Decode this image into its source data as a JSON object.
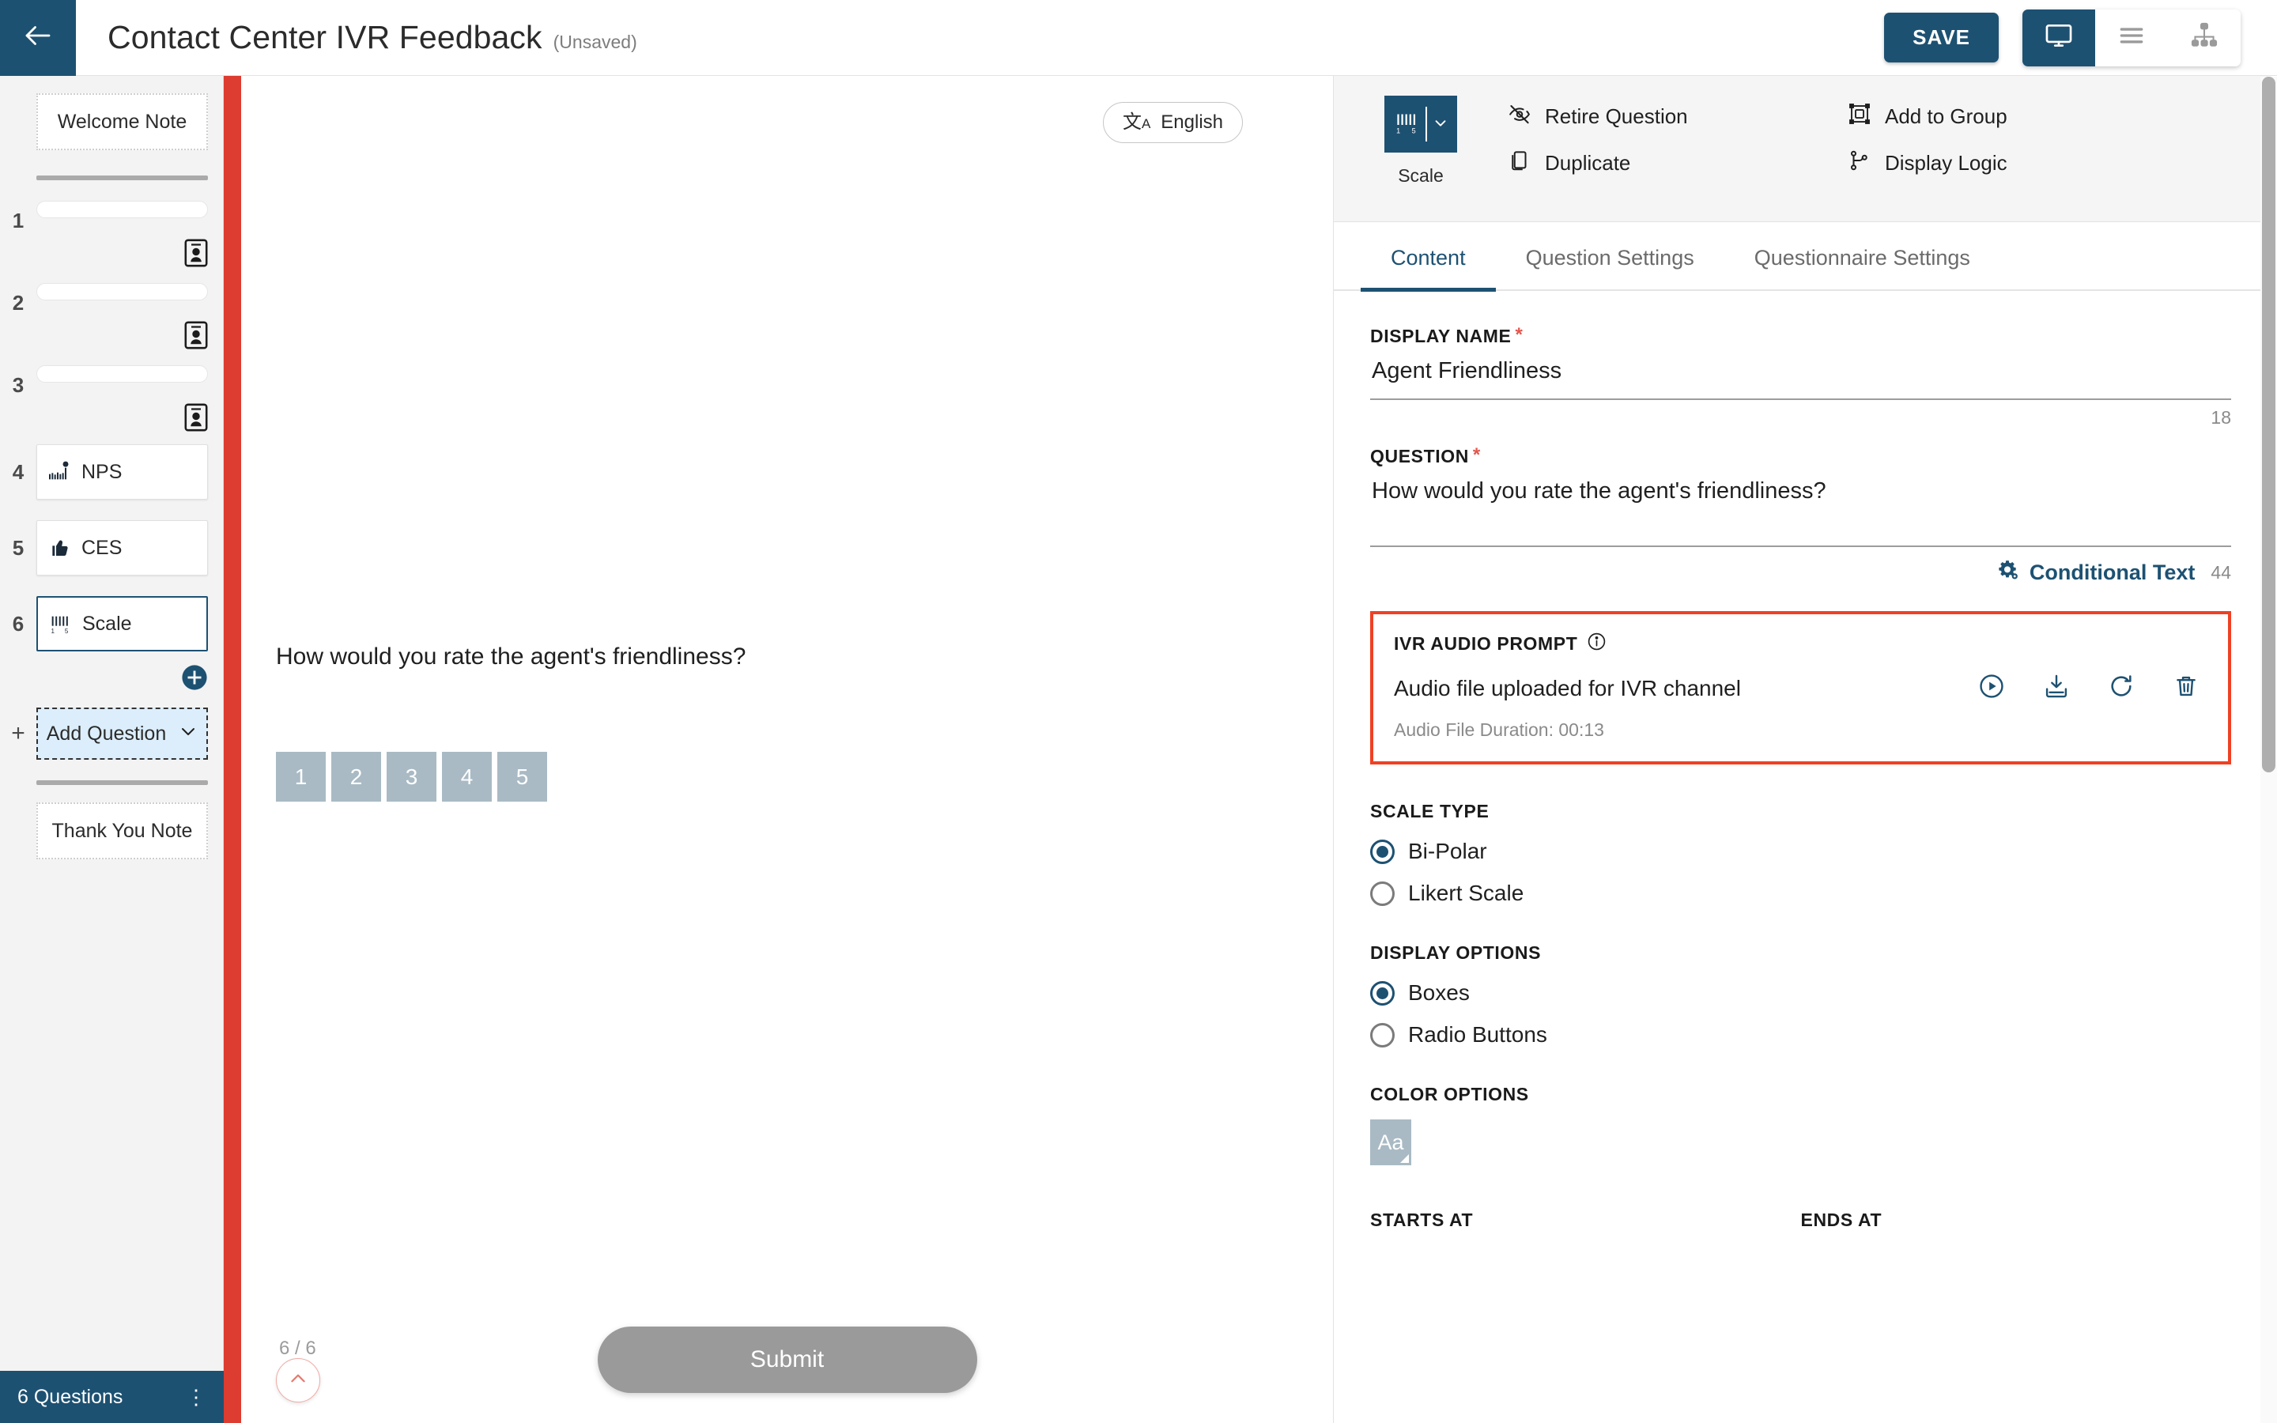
{
  "topbar": {
    "back_icon": "arrow-left-icon",
    "title": "Contact Center IVR Feedback",
    "status": "(Unsaved)",
    "save_label": "SAVE",
    "view_modes": [
      {
        "name": "desktop-preview",
        "icon": "monitor-icon",
        "active": true
      },
      {
        "name": "list-view",
        "icon": "list-icon",
        "active": false
      },
      {
        "name": "tree-view",
        "icon": "sitemap-icon",
        "active": false
      }
    ],
    "accent_color": "#1d5172"
  },
  "sidebar": {
    "welcome_note": "Welcome Note",
    "thank_you_note": "Thank You Note",
    "questions": [
      {
        "num": "1",
        "label": "",
        "type": "placeholder",
        "icon": "contact-card-icon",
        "selected": false
      },
      {
        "num": "2",
        "label": "",
        "type": "placeholder",
        "icon": "contact-card-icon",
        "selected": false
      },
      {
        "num": "3",
        "label": "",
        "type": "placeholder",
        "icon": "contact-card-icon",
        "selected": false
      },
      {
        "num": "4",
        "label": "NPS",
        "type": "card",
        "icon": "nps-icon",
        "selected": false
      },
      {
        "num": "5",
        "label": "CES",
        "type": "card",
        "icon": "thumbs-up-icon",
        "selected": false
      },
      {
        "num": "6",
        "label": "Scale",
        "type": "card",
        "icon": "scale-icon",
        "selected": true
      }
    ],
    "add_question_label": "Add Question",
    "add_icon": "plus-circle-icon",
    "footer_count": "6 Questions",
    "footer_menu_icon": "kebab-menu-icon",
    "rail_color": "#dd3c30"
  },
  "preview": {
    "language_label": "English",
    "language_icon": "translate-icon",
    "question_text": "How would you rate the agent's friendliness?",
    "scale_values": [
      "1",
      "2",
      "3",
      "4",
      "5"
    ],
    "scale_box_color": "#a9bac4",
    "page_indicator": "6 / 6",
    "collapse_icon": "chevron-up-icon",
    "submit_label": "Submit"
  },
  "right_panel": {
    "question_type": {
      "label": "Scale",
      "icon": "scale-icon",
      "dropdown_icon": "chevron-down-icon"
    },
    "toolbar_actions": [
      {
        "label": "Retire Question",
        "icon": "eye-off-icon"
      },
      {
        "label": "Add to Group",
        "icon": "group-icon"
      },
      {
        "label": "Duplicate",
        "icon": "duplicate-icon"
      },
      {
        "label": "Display Logic",
        "icon": "branch-icon"
      }
    ],
    "tabs": [
      {
        "label": "Content",
        "active": true
      },
      {
        "label": "Question Settings",
        "active": false
      },
      {
        "label": "Questionnaire Settings",
        "active": false
      }
    ],
    "display_name": {
      "label": "DISPLAY NAME",
      "required": "*",
      "value": "Agent Friendliness",
      "counter": "18"
    },
    "question": {
      "label": "QUESTION",
      "required": "*",
      "value": "How would you rate the agent's friendliness?",
      "counter": "44",
      "conditional_text_label": "Conditional Text",
      "conditional_text_icon": "gears-icon"
    },
    "ivr_audio_prompt": {
      "label": "IVR AUDIO PROMPT",
      "info_icon": "info-icon",
      "status_text": "Audio file uploaded for IVR channel",
      "duration_text": "Audio File Duration: 00:13",
      "highlight_color": "#ef4123",
      "actions": [
        {
          "name": "play-icon"
        },
        {
          "name": "download-icon"
        },
        {
          "name": "refresh-icon"
        },
        {
          "name": "delete-icon"
        }
      ]
    },
    "scale_type": {
      "label": "SCALE TYPE",
      "options": [
        {
          "label": "Bi-Polar",
          "selected": true
        },
        {
          "label": "Likert Scale",
          "selected": false
        }
      ]
    },
    "display_options": {
      "label": "DISPLAY OPTIONS",
      "options": [
        {
          "label": "Boxes",
          "selected": true
        },
        {
          "label": "Radio Buttons",
          "selected": false
        }
      ]
    },
    "color_options": {
      "label": "COLOR OPTIONS",
      "swatch_text": "Aa",
      "swatch_color": "#a9bac4"
    },
    "range": {
      "starts_at_label": "STARTS AT",
      "ends_at_label": "ENDS AT"
    }
  }
}
